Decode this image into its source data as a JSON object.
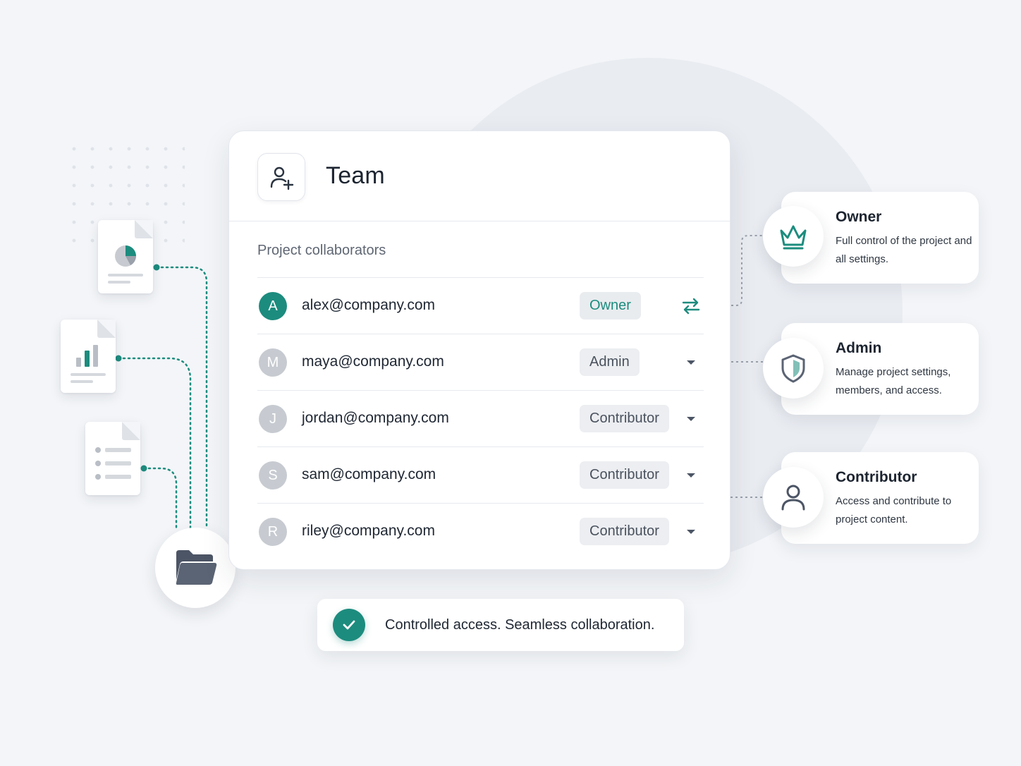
{
  "team": {
    "title": "Team",
    "section_label": "Project collaborators",
    "members": [
      {
        "initial": "A",
        "email": "alex@company.com",
        "role": "Owner",
        "action": "swap-arrows-icon",
        "active": true
      },
      {
        "initial": "M",
        "email": "maya@company.com",
        "role": "Admin",
        "action": "chevron-down-icon",
        "active": false
      },
      {
        "initial": "J",
        "email": "jordan@company.com",
        "role": "Contributor",
        "action": "chevron-down-icon",
        "active": false
      },
      {
        "initial": "S",
        "email": "sam@company.com",
        "role": "Contributor",
        "action": "chevron-down-icon",
        "active": false
      },
      {
        "initial": "R",
        "email": "riley@company.com",
        "role": "Contributor",
        "action": "chevron-down-icon",
        "active": false
      }
    ]
  },
  "roles": [
    {
      "name": "Owner",
      "description": "Full control of the project and all settings.",
      "icon": "crown-icon"
    },
    {
      "name": "Admin",
      "description": "Manage project settings, members, and access.",
      "icon": "shield-icon"
    },
    {
      "name": "Contributor",
      "description": "Access and contribute to project content.",
      "icon": "user-icon"
    }
  ],
  "banner": {
    "text": "Controlled access. Seamless collaboration.",
    "icon": "check-icon"
  },
  "colors": {
    "accent": "#1c8c7e",
    "background": "#f3f5f8",
    "card": "#ffffff",
    "muted_avatar": "#c7cbd1",
    "folder": "#5b6474"
  }
}
